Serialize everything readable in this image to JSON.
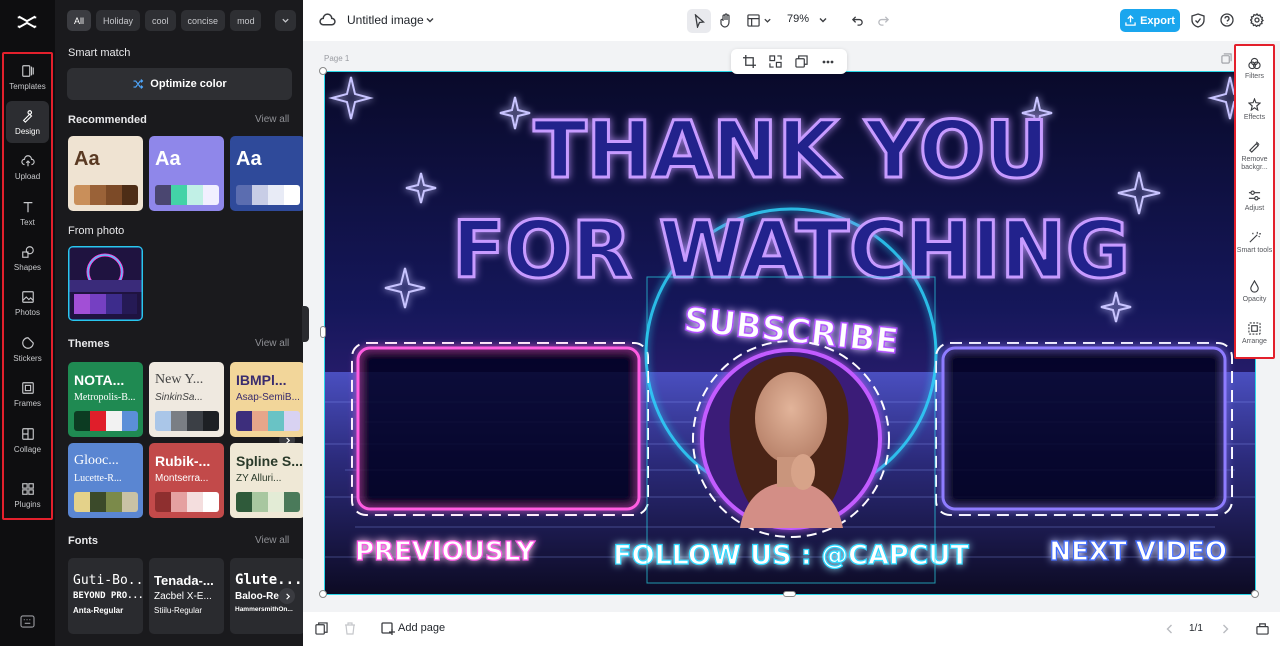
{
  "rail": {
    "items": [
      {
        "label": "Templates",
        "icon": "templates-icon"
      },
      {
        "label": "Design",
        "icon": "design-icon",
        "active": true
      },
      {
        "label": "Upload",
        "icon": "upload-icon"
      },
      {
        "label": "Text",
        "icon": "text-icon"
      },
      {
        "label": "Shapes",
        "icon": "shapes-icon"
      },
      {
        "label": "Photos",
        "icon": "photos-icon"
      },
      {
        "label": "Stickers",
        "icon": "stickers-icon"
      },
      {
        "label": "Frames",
        "icon": "frames-icon"
      },
      {
        "label": "Collage",
        "icon": "collage-icon"
      },
      {
        "label": "Plugins",
        "icon": "plugins-icon"
      }
    ]
  },
  "panel": {
    "chips": [
      "All",
      "Holiday",
      "cool",
      "concise",
      "mod"
    ],
    "smart_match": "Smart match",
    "optimize_color": "Optimize color",
    "recommended": {
      "title": "Recommended",
      "view_all": "View all",
      "cards": [
        {
          "text": "Aa",
          "bg": "#efe3d2",
          "fg": "#5a3a23",
          "swatches": [
            "#c98f5a",
            "#9a6238",
            "#7c4a27",
            "#4d2d16"
          ]
        },
        {
          "text": "Aa",
          "bg": "#8f87ea",
          "fg": "#ffffff",
          "swatches": [
            "#4a4670",
            "#43d3a7",
            "#c1f0e6",
            "#f1efff"
          ]
        },
        {
          "text": "Aa",
          "bg": "#2f4a9a",
          "fg": "#ffffff",
          "swatches": [
            "#5b6db0",
            "#c8cde6",
            "#e8ebf6",
            "#ffffff"
          ]
        }
      ]
    },
    "from_photo": "From photo",
    "themes": {
      "title": "Themes",
      "view_all": "View all",
      "cards": [
        {
          "t1": "NOTA...",
          "t2": "Metropolis-B...",
          "bg": "#1f8a52",
          "fg": "#ffffff",
          "swatches": [
            "#0c3b22",
            "#e01e2a",
            "#f2f2f2",
            "#5b8fd8"
          ]
        },
        {
          "t1": "New Y...",
          "t2": "SinkinSa...",
          "bg": "#efe9e0",
          "fg": "#444444",
          "swatches": [
            "#aac6e8",
            "#7a7e84",
            "#3b3f45",
            "#1d2024"
          ]
        },
        {
          "t1": "IBMPl...",
          "t2": "Asap-SemiB...",
          "bg": "#f2d69a",
          "fg": "#3a2c6e",
          "swatches": [
            "#3d2e7c",
            "#e7a68a",
            "#69c3c5",
            "#d8d2f2"
          ]
        },
        {
          "t1": "Glooc...",
          "t2": "Lucette-R...",
          "bg": "#5a86d2",
          "fg": "#ffffff",
          "swatches": [
            "#e4d28a",
            "#3b4a2a",
            "#7b8a4a",
            "#c9c2a5"
          ]
        },
        {
          "t1": "Rubik-...",
          "t2": "Montserra...",
          "bg": "#c24a4a",
          "fg": "#ffffff",
          "swatches": [
            "#8e2f2f",
            "#e5a1a1",
            "#f4dede",
            "#ffffff"
          ]
        },
        {
          "t1": "Spline S...",
          "t2": "ZY Alluri...",
          "bg": "#efe8d6",
          "fg": "#2a3a2a",
          "swatches": [
            "#2f5a3a",
            "#a8c7a0",
            "#e3ecd6",
            "#4a7a5a"
          ]
        }
      ]
    },
    "fonts": {
      "title": "Fonts",
      "view_all": "View all",
      "cards": [
        {
          "l1": "Guti-Bo...",
          "l2": "BEYOND PRO...",
          "l3": "Anta-Regular"
        },
        {
          "l1": "Tenada-...",
          "l2": "Zacbel X-E...",
          "l3": "Stiilu-Regular"
        },
        {
          "l1": "Glute...",
          "l2": "Baloo-Re...",
          "l3": "HammersmithOn..."
        }
      ]
    }
  },
  "topbar": {
    "title": "Untitled image",
    "zoom": "79%",
    "export": "Export"
  },
  "canvas": {
    "page_label": "Page 1",
    "artwork": {
      "title_line1": "THANK YOU",
      "title_line2": "FOR WATCHING",
      "subscribe": "SUBSCRIBE",
      "previously": "PREVIOUSLY",
      "follow": "FOLLOW US : @CAPCUT",
      "next_video": "NEXT VIDEO"
    }
  },
  "right_tools": [
    {
      "label": "Filters",
      "icon": "filters-icon"
    },
    {
      "label": "Effects",
      "icon": "effects-icon"
    },
    {
      "label": "Remove backgr...",
      "icon": "remove-background-icon"
    },
    {
      "label": "Adjust",
      "icon": "adjust-icon"
    },
    {
      "label": "Smart tools",
      "icon": "smart-tools-icon"
    },
    {
      "label": "Opacity",
      "icon": "opacity-icon"
    },
    {
      "label": "Arrange",
      "icon": "arrange-icon"
    }
  ],
  "bottombar": {
    "add_page": "Add page",
    "pager": "1/1"
  },
  "colors": {
    "accent": "#1aa6ee",
    "highlight_box": "#e3202c",
    "selection": "#2ad6e8"
  }
}
